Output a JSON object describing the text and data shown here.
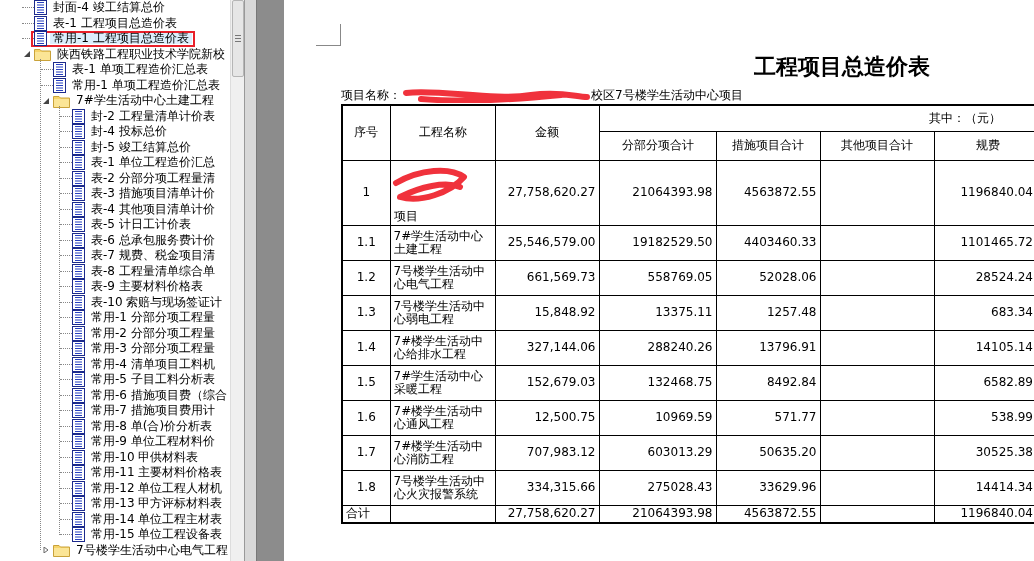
{
  "tree": {
    "items": [
      {
        "kind": "file",
        "label": "封面-4 竣工结算总价",
        "selected": false
      },
      {
        "kind": "file",
        "label": "表-1 工程项目总造价表",
        "selected": false
      },
      {
        "kind": "file",
        "label": "常用-1 工程项目总造价表",
        "selected": true
      },
      {
        "kind": "folder",
        "label": "陕西铁路工程职业技术学院新校",
        "selected": false,
        "expanded": true,
        "children": [
          {
            "kind": "file",
            "label": "表-1 单项工程造价汇总表",
            "selected": false
          },
          {
            "kind": "file",
            "label": "常用-1 单项工程造价汇总表",
            "selected": false
          },
          {
            "kind": "folder",
            "label": "7#学生活动中心土建工程",
            "selected": false,
            "expanded": true,
            "children": [
              {
                "kind": "file",
                "label": "封-2 工程量清单计价表",
                "selected": false
              },
              {
                "kind": "file",
                "label": "封-4 投标总价",
                "selected": false
              },
              {
                "kind": "file",
                "label": "封-5 竣工结算总价",
                "selected": false
              },
              {
                "kind": "file",
                "label": "表-1 单位工程造价汇总",
                "selected": false
              },
              {
                "kind": "file",
                "label": "表-2 分部分项工程量清",
                "selected": false
              },
              {
                "kind": "file",
                "label": "表-3 措施项目清单计价",
                "selected": false
              },
              {
                "kind": "file",
                "label": "表-4 其他项目清单计价",
                "selected": false
              },
              {
                "kind": "file",
                "label": "表-5 计日工计价表",
                "selected": false
              },
              {
                "kind": "file",
                "label": "表-6 总承包服务费计价",
                "selected": false
              },
              {
                "kind": "file",
                "label": "表-7 规费、税金项目清",
                "selected": false
              },
              {
                "kind": "file",
                "label": "表-8 工程量清单综合单",
                "selected": false
              },
              {
                "kind": "file",
                "label": "表-9 主要材料价格表",
                "selected": false
              },
              {
                "kind": "file",
                "label": "表-10 索赔与现场签证计",
                "selected": false
              },
              {
                "kind": "file",
                "label": "常用-1 分部分项工程量",
                "selected": false
              },
              {
                "kind": "file",
                "label": "常用-2 分部分项工程量",
                "selected": false
              },
              {
                "kind": "file",
                "label": "常用-3 分部分项工程量",
                "selected": false
              },
              {
                "kind": "file",
                "label": "常用-4 清单项目工料机",
                "selected": false
              },
              {
                "kind": "file",
                "label": "常用-5 子目工料分析表",
                "selected": false
              },
              {
                "kind": "file",
                "label": "常用-6 措施项目费（综合",
                "selected": false
              },
              {
                "kind": "file",
                "label": "常用-7 措施项目费用计",
                "selected": false
              },
              {
                "kind": "file",
                "label": "常用-8 单(合)价分析表",
                "selected": false
              },
              {
                "kind": "file",
                "label": "常用-9 单位工程材料价",
                "selected": false
              },
              {
                "kind": "file",
                "label": "常用-10 甲供材料表",
                "selected": false
              },
              {
                "kind": "file",
                "label": "常用-11 主要材料价格表",
                "selected": false
              },
              {
                "kind": "file",
                "label": "常用-12 单位工程人材机",
                "selected": false
              },
              {
                "kind": "file",
                "label": "常用-13 甲方评标材料表",
                "selected": false
              },
              {
                "kind": "file",
                "label": "常用-14 单位工程主材表",
                "selected": false
              },
              {
                "kind": "file",
                "label": "常用-15 单位工程设备表",
                "selected": false
              }
            ]
          },
          {
            "kind": "folder",
            "label": "7号楼学生活动中心电气工程",
            "selected": false,
            "expanded": false
          }
        ]
      }
    ]
  },
  "document": {
    "title": "工程项目总造价表",
    "project_label": "项目名称：",
    "project_value": "校区7号楼学生活动中心项目",
    "unit_note": "其中：（元）",
    "columns": [
      "序号",
      "工程名称",
      "金额",
      "分部分项合计",
      "措施项目合计",
      "其他项目合计",
      "规费"
    ],
    "rows": [
      {
        "no": "1",
        "name": "项目",
        "redacted": true,
        "amount": "27,758,620.27",
        "sub": "21064393.98",
        "measures": "4563872.55",
        "fees": "1196840.04"
      },
      {
        "no": "1.1",
        "name": "7#学生活动中心土建工程",
        "redacted": false,
        "amount": "25,546,579.00",
        "sub": "19182529.50",
        "measures": "4403460.33",
        "fees": "1101465.72"
      },
      {
        "no": "1.2",
        "name": "7号楼学生活动中心电气工程",
        "redacted": false,
        "amount": "661,569.73",
        "sub": "558769.05",
        "measures": "52028.06",
        "fees": "28524.24"
      },
      {
        "no": "1.3",
        "name": "7号楼学生活动中心弱电工程",
        "redacted": false,
        "amount": "15,848.92",
        "sub": "13375.11",
        "measures": "1257.48",
        "fees": "683.34"
      },
      {
        "no": "1.4",
        "name": "7#楼学生活动中心给排水工程",
        "redacted": false,
        "amount": "327,144.06",
        "sub": "288240.26",
        "measures": "13796.91",
        "fees": "14105.14"
      },
      {
        "no": "1.5",
        "name": "7#学生活动中心采暖工程",
        "redacted": false,
        "amount": "152,679.03",
        "sub": "132468.75",
        "measures": "8492.84",
        "fees": "6582.89"
      },
      {
        "no": "1.6",
        "name": "7#楼学生活动中心通风工程",
        "redacted": false,
        "amount": "12,500.75",
        "sub": "10969.59",
        "measures": "571.77",
        "fees": "538.99"
      },
      {
        "no": "1.7",
        "name": "7#楼学生活动中心消防工程",
        "redacted": false,
        "amount": "707,983.12",
        "sub": "603013.29",
        "measures": "50635.20",
        "fees": "30525.38"
      },
      {
        "no": "1.8",
        "name": "7号楼学生活动中心火灾报警系统",
        "redacted": false,
        "amount": "334,315.66",
        "sub": "275028.43",
        "measures": "33629.96",
        "fees": "14414.34"
      }
    ],
    "total": {
      "label": "合计",
      "amount": "27,758,620.27",
      "sub": "21064393.98",
      "measures": "4563872.55",
      "fees": "1196840.04"
    }
  }
}
